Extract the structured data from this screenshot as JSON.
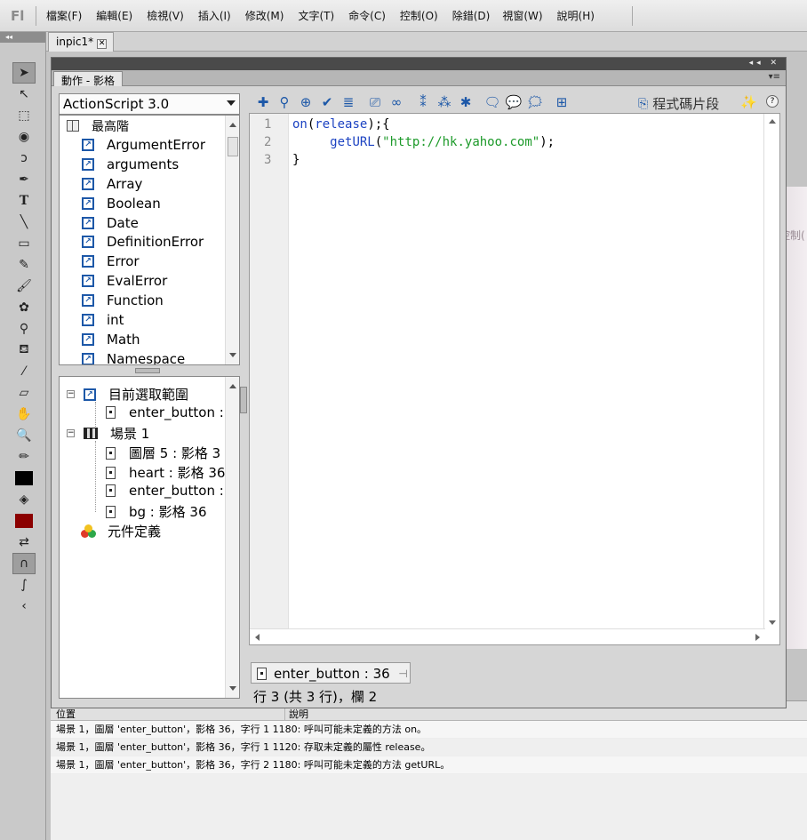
{
  "app": {
    "logo": "Fl"
  },
  "menu": [
    "檔案(F)",
    "編輯(E)",
    "檢視(V)",
    "插入(I)",
    "修改(M)",
    "文字(T)",
    "命令(C)",
    "控制(O)",
    "除錯(D)",
    "視窗(W)",
    "說明(H)"
  ],
  "toolrail": {
    "collapse": "◂◂"
  },
  "document_tab": {
    "name": "inpic1*",
    "close": "✕"
  },
  "stage_deco_text": "控制(",
  "panel": {
    "controls": "◂◂ ✕",
    "title": "動作 - 影格",
    "options": "▾≡",
    "language": "ActionScript 3.0",
    "library_header": "最高階",
    "library_items": [
      "ArgumentError",
      "arguments",
      "Array",
      "Boolean",
      "Date",
      "DefinitionError",
      "Error",
      "EvalError",
      "Function",
      "int",
      "Math",
      "Namespace"
    ],
    "tree": {
      "current": "目前選取範圍",
      "current_child": "enter_button :",
      "scene": "場景 1",
      "scene_children": [
        "圖層 5 : 影格 3",
        "heart : 影格 36",
        "enter_button :",
        "bg : 影格 36"
      ],
      "symbols": "元件定義"
    },
    "snippets_label": "程式碼片段",
    "help": "?",
    "code_lines": [
      {
        "n": "1",
        "parts": [
          {
            "t": "on",
            "c": "kw"
          },
          {
            "t": "(",
            "c": ""
          },
          {
            "t": "release",
            "c": "kw"
          },
          {
            "t": ");{",
            "c": ""
          }
        ]
      },
      {
        "n": "2",
        "parts": [
          {
            "t": "     ",
            "c": ""
          },
          {
            "t": "getURL",
            "c": "kw"
          },
          {
            "t": "(",
            "c": ""
          },
          {
            "t": "\"http://hk.yahoo.com\"",
            "c": "str"
          },
          {
            "t": ");",
            "c": ""
          }
        ]
      },
      {
        "n": "3",
        "parts": [
          {
            "t": "}",
            "c": ""
          }
        ]
      }
    ],
    "script_tab": "enter_button : 36",
    "status": "行 3 (共 3 行)，欄 2"
  },
  "output": {
    "col_location": "位置",
    "col_description": "說明",
    "rows": [
      "場景 1，圖層 'enter_button'，影格 36，字行 1   1180: 呼叫可能未定義的方法 on。",
      "場景 1，圖層 'enter_button'，影格 36，字行 1   1120: 存取未定義的屬性 release。",
      "場景 1，圖層 'enter_button'，影格 36，字行 2   1180: 呼叫可能未定義的方法 getURL。"
    ]
  },
  "colors": {
    "keyword": "#1d43c2",
    "string": "#1d9a2a",
    "fill": "#8b0000"
  }
}
